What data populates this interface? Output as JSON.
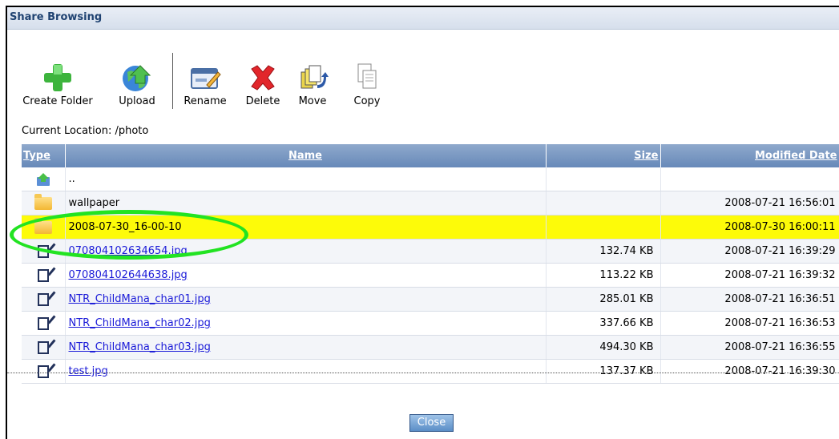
{
  "window": {
    "title": "Share Browsing"
  },
  "toolbar": {
    "create_folder": "Create Folder",
    "upload": "Upload",
    "rename": "Rename",
    "delete": "Delete",
    "move": "Move",
    "copy": "Copy"
  },
  "location": "Current Location: /photo",
  "table": {
    "headers": {
      "type": "Type",
      "name": "Name",
      "size": "Size",
      "modified": "Modified Date"
    },
    "parent": "..",
    "rows": [
      {
        "name": "wallpaper",
        "size": "",
        "date": "2008-07-21 16:56:01"
      },
      {
        "name": "2008-07-30_16-00-10",
        "size": "",
        "date": "2008-07-30 16:00:11"
      },
      {
        "name": "070804102634654.jpg",
        "size": "132.74 KB",
        "date": "2008-07-21 16:39:29"
      },
      {
        "name": "070804102644638.jpg",
        "size": "113.22 KB",
        "date": "2008-07-21 16:39:32"
      },
      {
        "name": "NTR_ChildMana_char01.jpg",
        "size": "285.01 KB",
        "date": "2008-07-21 16:36:51"
      },
      {
        "name": "NTR_ChildMana_char02.jpg",
        "size": "337.66 KB",
        "date": "2008-07-21 16:36:53"
      },
      {
        "name": "NTR_ChildMana_char03.jpg",
        "size": "494.30 KB",
        "date": "2008-07-21 16:36:55"
      },
      {
        "name": "test.jpg",
        "size": "137.37 KB",
        "date": "2008-07-21 16:39:30"
      }
    ]
  },
  "close_label": "Close",
  "icons": {
    "create_folder": "plus-icon",
    "upload": "globe-upload-icon",
    "rename": "rename-icon",
    "delete": "delete-x-icon",
    "move": "move-icon",
    "copy": "copy-icon"
  },
  "colors": {
    "highlight": "#fdfb09",
    "annotation_ring": "#22e322",
    "header": "#6f8fbe",
    "link": "#1a1ad8"
  }
}
